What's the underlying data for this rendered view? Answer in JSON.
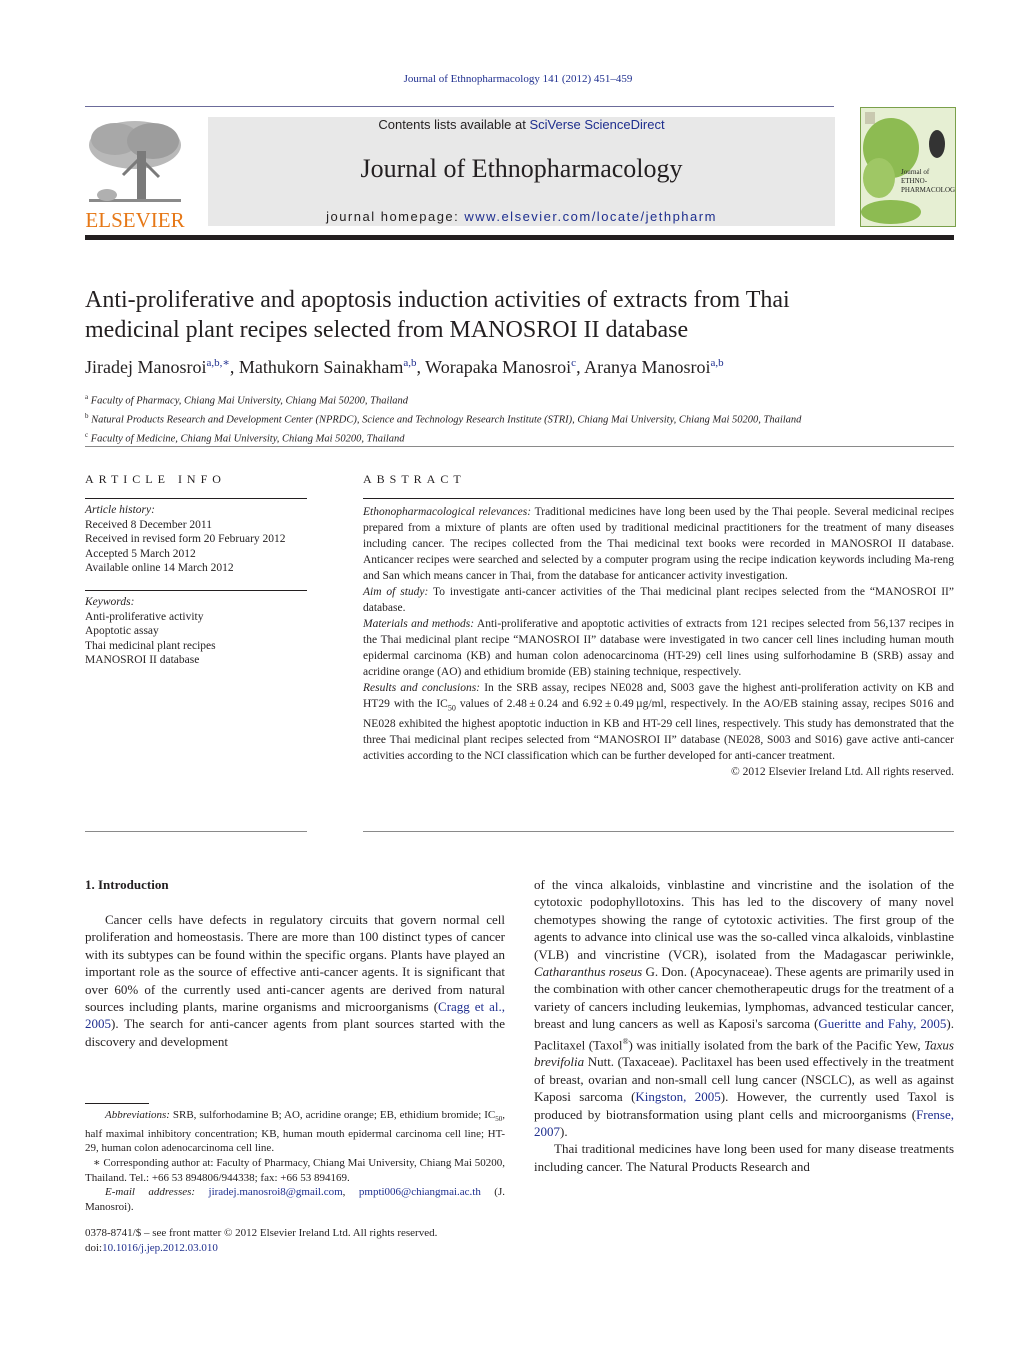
{
  "header": {
    "citation": "Journal of Ethnopharmacology 141 (2012) 451–459",
    "contents_prefix": "Contents lists available at ",
    "contents_link": "SciVerse ScienceDirect",
    "journal_title": "Journal of Ethnopharmacology",
    "homepage_prefix": "journal homepage: ",
    "homepage_link": "www.elsevier.com/locate/jethpharm",
    "publisher_logo": "ELSEVIER",
    "cover_title_lines": [
      "Journal of",
      "ETHNO-",
      "PHARMACOLOGY"
    ],
    "colors": {
      "link": "#1f2f8f",
      "elsevier_orange": "#e67817",
      "masthead_bg": "#e8e8e8",
      "cover_bg": "#e6efd3"
    }
  },
  "article": {
    "title_line1": "Anti-proliferative and apoptosis induction activities of extracts from Thai",
    "title_line2": "medicinal plant recipes selected from MANOSROI II database",
    "authors": [
      {
        "name": "Jiradej Manosroi",
        "sup": "a,b,∗"
      },
      {
        "name": "Mathukorn Sainakham",
        "sup": "a,b"
      },
      {
        "name": "Worapaka Manosroi",
        "sup": "c"
      },
      {
        "name": "Aranya Manosroi",
        "sup": "a,b"
      }
    ],
    "affiliations": [
      {
        "key": "a",
        "text": "Faculty of Pharmacy, Chiang Mai University, Chiang Mai 50200, Thailand"
      },
      {
        "key": "b",
        "text": "Natural Products Research and Development Center (NPRDC), Science and Technology Research Institute (STRI), Chiang Mai University, Chiang Mai 50200, Thailand"
      },
      {
        "key": "c",
        "text": "Faculty of Medicine, Chiang Mai University, Chiang Mai 50200, Thailand"
      }
    ]
  },
  "article_info": {
    "heading": "ARTICLE INFO",
    "history_label": "Article history:",
    "history": [
      "Received 8 December 2011",
      "Received in revised form 20 February 2012",
      "Accepted 5 March 2012",
      "Available online 14 March 2012"
    ],
    "keywords_label": "Keywords:",
    "keywords": [
      "Anti-proliferative activity",
      "Apoptotic assay",
      "Thai medicinal plant recipes",
      "MANOSROI II database"
    ]
  },
  "abstract": {
    "heading": "ABSTRACT",
    "sections": [
      {
        "label": "Ethonopharmacological relevances:",
        "text": " Traditional medicines have long been used by the Thai people. Several medicinal recipes prepared from a mixture of plants are often used by traditional medicinal practitioners for the treatment of many diseases including cancer. The recipes collected from the Thai medicinal text books were recorded in MANOSROI II database. Anticancer recipes were searched and selected by a computer program using the recipe indication keywords including Ma-reng and San which means cancer in Thai, from the database for anticancer activity investigation."
      },
      {
        "label": "Aim of study:",
        "text": " To investigate anti-cancer activities of the Thai medicinal plant recipes selected from the “MANOSROI II” database."
      },
      {
        "label": "Materials and methods:",
        "text": " Anti-proliferative and apoptotic activities of extracts from 121 recipes selected from 56,137 recipes in the Thai medicinal plant recipe “MANOSROI II” database were investigated in two cancer cell lines including human mouth epidermal carcinoma (KB) and human colon adenocarcinoma (HT-29) cell lines using sulforhodamine B (SRB) assay and acridine orange (AO) and ethidium bromide (EB) staining technique, respectively."
      },
      {
        "label": "Results and conclusions:",
        "text_a": " In the SRB assay, recipes NE028 and, S003 gave the highest anti-proliferation activity on KB and HT29 with the IC",
        "sub": "50",
        "text_b": " values of 2.48 ± 0.24 and 6.92 ± 0.49 µg/ml, respectively. In the AO/EB staining assay, recipes S016 and NE028 exhibited the highest apoptotic induction in KB and HT-29 cell lines, respectively. This study has demonstrated that the three Thai medicinal plant recipes selected from “MANOSROI II” database (NE028, S003 and S016) gave active anti-cancer activities according to the NCI classification which can be further developed for anti-cancer treatment."
      }
    ],
    "copyright": "© 2012 Elsevier Ireland Ltd. All rights reserved."
  },
  "introduction": {
    "heading": "1.  Introduction",
    "p1_a": "Cancer cells have defects in regulatory circuits that govern normal cell proliferation and homeostasis. There are more than 100 distinct types of cancer with its subtypes can be found within the specific organs. Plants have played an important role as the source of effective anti-cancer agents. It is significant that over 60% of the currently used anti-cancer agents are derived from natural sources including plants, marine organisms and microorganisms (",
    "p1_ref": "Cragg et al., 2005",
    "p1_b": "). The search for anti-cancer agents from plant sources started with the discovery and development",
    "p1_c": "of the vinca alkaloids, vinblastine and vincristine and the isolation of the cytotoxic podophyllotoxins. This has led to the discovery of many novel chemotypes showing the range of cytotoxic activities. The first group of the agents to advance into clinical use was the so-called vinca alkaloids, vinblastine (VLB) and vincristine (VCR), isolated from the Madagascar periwinkle, ",
    "p1_species1": "Catharanthus roseus",
    "p1_d": " G. Don. (Apocynaceae). These agents are primarily used in the combination with other cancer chemotherapeutic drugs for the treatment of a variety of cancers including leukemias, lymphomas, advanced testicular cancer, breast and lung cancers as well as Kaposi's sarcoma (",
    "p1_ref2": "Gueritte and Fahy, 2005",
    "p1_e": "). Paclitaxel (Taxol",
    "p1_reg": "®",
    "p1_f": ") was initially isolated from the bark of the Pacific Yew, ",
    "p1_species2": "Taxus brevifolia",
    "p1_g": " Nutt. (Taxaceae). Paclitaxel has been used effectively in the treatment of breast, ovarian and non-small cell lung cancer (NSCLC), as well as against Kaposi sarcoma (",
    "p1_ref3": "Kingston, 2005",
    "p1_h": "). However, the currently used Taxol is produced by biotransformation using plant cells and microorganisms (",
    "p1_ref4": "Frense, 2007",
    "p1_i": ").",
    "p2": "Thai traditional medicines have long been used for many disease treatments including cancer. The Natural Products Research and"
  },
  "footnotes": {
    "abbrev_label": "Abbreviations:",
    "abbrev_a": "  SRB, sulforhodamine B; AO, acridine orange; EB, ethidium bromide; IC",
    "abbrev_sub": "50",
    "abbrev_b": ", half maximal inhibitory concentration; KB, human mouth epidermal carcinoma cell line; HT-29, human colon adenocarcinoma cell line.",
    "corresponding": "∗ Corresponding author at: Faculty of Pharmacy, Chiang Mai University, Chiang Mai 50200, Thailand. Tel.: +66 53 894806/944338; fax: +66 53 894169.",
    "email_label": "E-mail addresses:",
    "email1": "jiradej.manosroi8@gmail.com",
    "email2": "pmpti006@chiangmai.ac.th",
    "email_suffix": "(J. Manosroi).",
    "front_matter": "0378-8741/$ – see front matter © 2012 Elsevier Ireland Ltd. All rights reserved.",
    "doi_prefix": "doi:",
    "doi": "10.1016/j.jep.2012.03.010"
  }
}
